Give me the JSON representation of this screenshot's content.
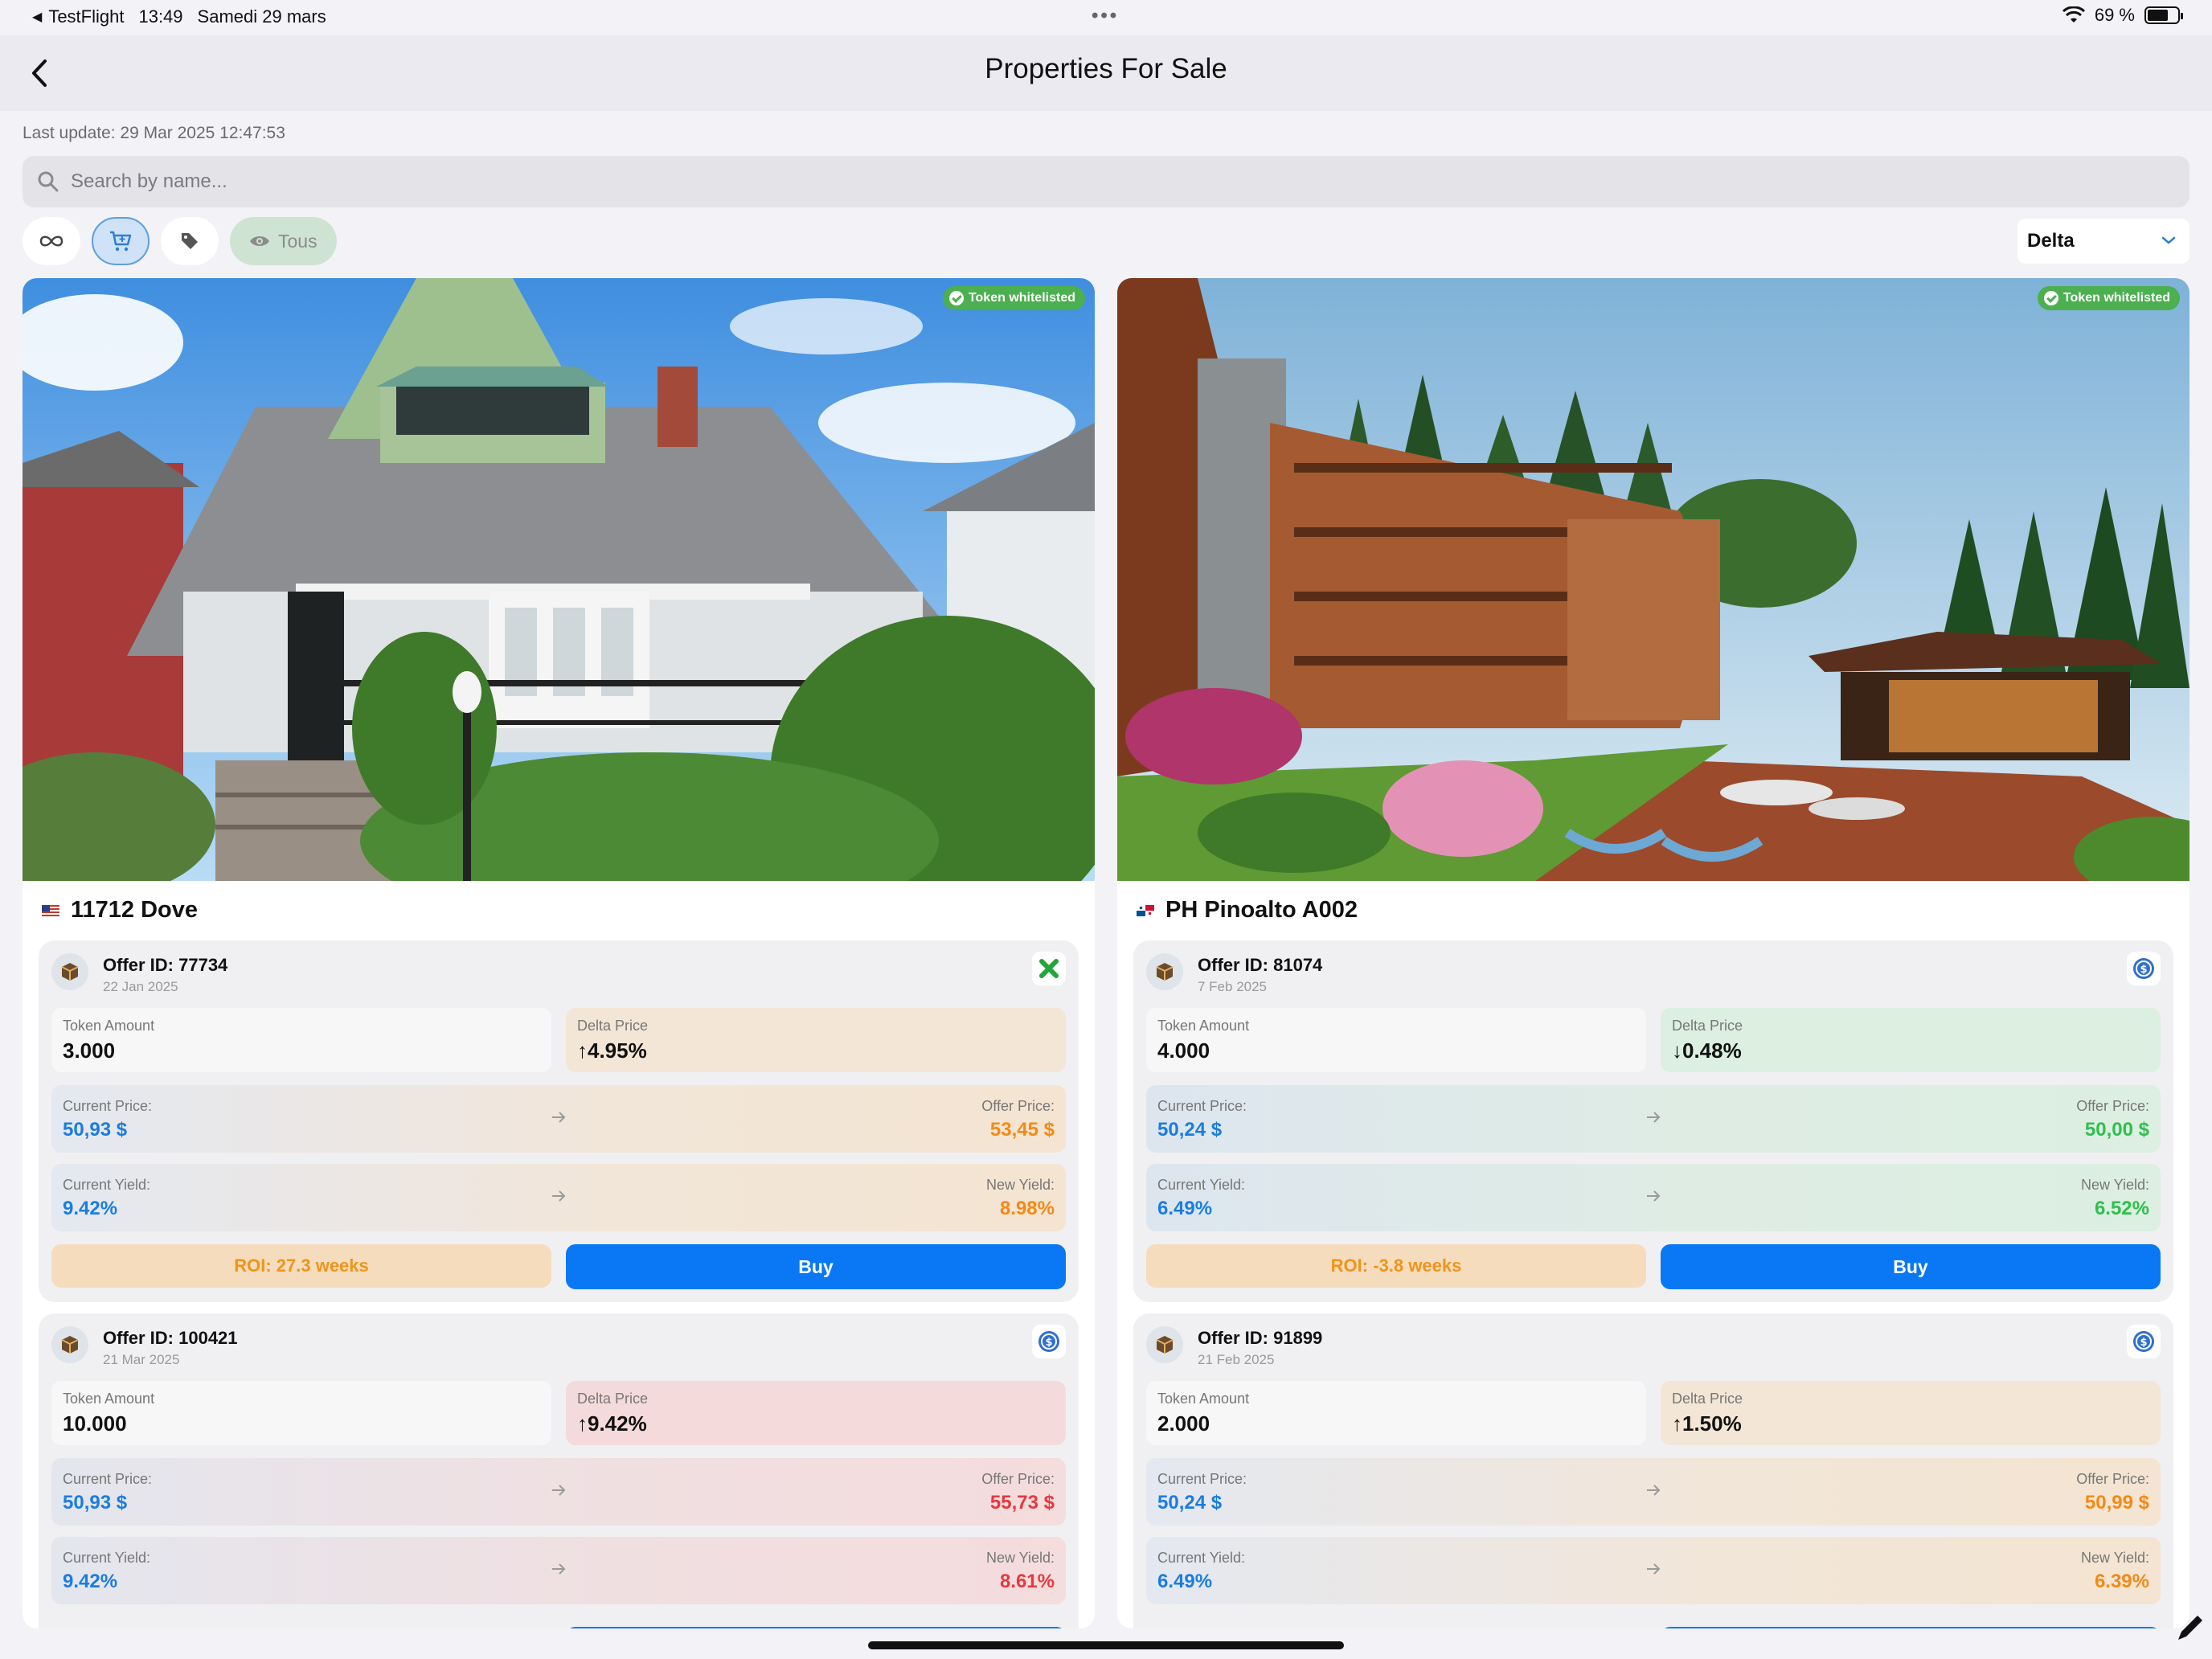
{
  "status_bar": {
    "app": "TestFlight",
    "time": "13:49",
    "date": "Samedi 29 mars",
    "battery": "69 %",
    "battery_level": 0.69
  },
  "nav": {
    "title": "Properties For Sale"
  },
  "last_update": "Last update: 29 Mar 2025 12:47:53",
  "search": {
    "placeholder": "Search by name...",
    "value": ""
  },
  "filters": {
    "chips": [
      {
        "icon": "infinity-icon",
        "active": false
      },
      {
        "icon": "cart-icon",
        "active": true
      },
      {
        "icon": "tag-icon",
        "active": false
      }
    ],
    "visibility": {
      "icon": "eye-icon",
      "label": "Tous"
    },
    "sort": {
      "selected": "Delta"
    }
  },
  "properties": [
    {
      "name": "11712 Dove",
      "flag": "us-flag-icon",
      "whitelist_label": "Token whitelisted",
      "offers": [
        {
          "id": "Offer ID: 77734",
          "date": "22 Jan 2025",
          "badge": "x-close-icon",
          "token_amount_label": "Token Amount",
          "token_amount": "3.000",
          "delta_label": "Delta Price",
          "delta": "↑4.95%",
          "current_price_label": "Current Price:",
          "current_price": "50,93 $",
          "offer_price_label": "Offer Price:",
          "offer_price": "53,45 $",
          "current_yield_label": "Current Yield:",
          "current_yield": "9.42%",
          "new_yield_label": "New Yield:",
          "new_yield": "8.98%",
          "roi": "ROI: 27.3 weeks",
          "buy": "Buy",
          "tone": "orange"
        },
        {
          "id": "Offer ID: 100421",
          "date": "21 Mar 2025",
          "badge": "dollar-coin-icon",
          "token_amount_label": "Token Amount",
          "token_amount": "10.000",
          "delta_label": "Delta Price",
          "delta": "↑9.42%",
          "current_price_label": "Current Price:",
          "current_price": "50,93 $",
          "offer_price_label": "Offer Price:",
          "offer_price": "55,73 $",
          "current_yield_label": "Current Yield:",
          "current_yield": "9.42%",
          "new_yield_label": "New Yield:",
          "new_yield": "8.61%",
          "tone": "red"
        }
      ]
    },
    {
      "name": "PH Pinoalto A002",
      "flag": "panama-flag-icon",
      "whitelist_label": "Token whitelisted",
      "offers": [
        {
          "id": "Offer ID: 81074",
          "date": "7 Feb 2025",
          "badge": "dollar-coin-icon",
          "token_amount_label": "Token Amount",
          "token_amount": "4.000",
          "delta_label": "Delta Price",
          "delta": "↓0.48%",
          "current_price_label": "Current Price:",
          "current_price": "50,24 $",
          "offer_price_label": "Offer Price:",
          "offer_price": "50,00 $",
          "current_yield_label": "Current Yield:",
          "current_yield": "6.49%",
          "new_yield_label": "New Yield:",
          "new_yield": "6.52%",
          "roi": "ROI: -3.8 weeks",
          "buy": "Buy",
          "tone": "green"
        },
        {
          "id": "Offer ID: 91899",
          "date": "21 Feb 2025",
          "badge": "dollar-coin-icon",
          "token_amount_label": "Token Amount",
          "token_amount": "2.000",
          "delta_label": "Delta Price",
          "delta": "↑1.50%",
          "current_price_label": "Current Price:",
          "current_price": "50,24 $",
          "offer_price_label": "Offer Price:",
          "offer_price": "50,99 $",
          "current_yield_label": "Current Yield:",
          "current_yield": "6.49%",
          "new_yield_label": "New Yield:",
          "new_yield": "6.39%",
          "tone": "orange"
        }
      ]
    }
  ]
}
